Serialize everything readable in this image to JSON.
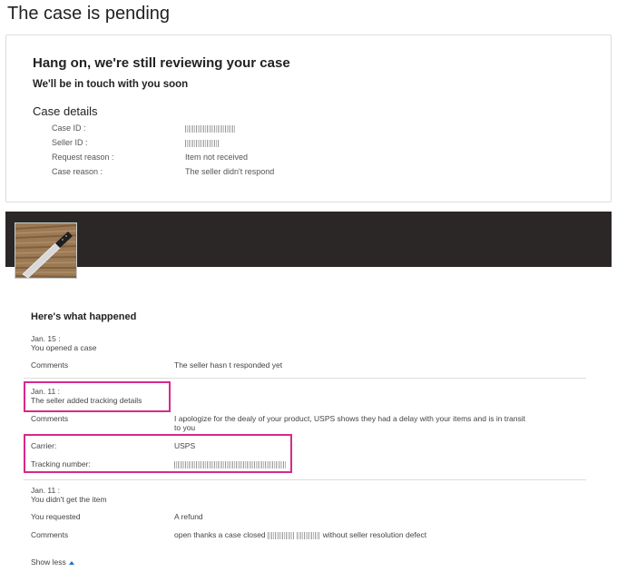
{
  "page": {
    "title": "The case is pending"
  },
  "review": {
    "heading": "Hang on, we're still reviewing your case",
    "subheading": "We'll be in touch with you soon",
    "details_heading": "Case details",
    "details": [
      {
        "label": "Case ID :",
        "value": ""
      },
      {
        "label": "Seller ID :",
        "value": ""
      },
      {
        "label": "Request reason :",
        "value": "Item not received"
      },
      {
        "label": "Case reason :",
        "value": "The seller didn't respond"
      }
    ]
  },
  "item": {
    "thumbnail_icon": "knife-on-wood-image"
  },
  "timeline": {
    "heading": "Here's what happened",
    "events": [
      {
        "date": "Jan. 15 :",
        "title": "You opened a case",
        "comments_label": "Comments",
        "comments_value": "The seller hasn t responded yet"
      },
      {
        "date": "Jan. 11 :",
        "title": "The seller added tracking details",
        "comments_label": "Comments",
        "comments_value_line1": "I apologize for the dealy of your product, USPS shows they had a delay with your items and is in transit",
        "comments_value_line2": "to you",
        "carrier_label": "Carrier:",
        "carrier_value": "USPS",
        "tracking_label": "Tracking number:",
        "tracking_value": ""
      },
      {
        "date": "Jan. 11 :",
        "title": "You didn't get the item",
        "requested_label": "You requested",
        "requested_value": "A refund",
        "comments_label": "Comments",
        "comments_pre": "open thanks a case closed",
        "comments_post": "without seller resolution defect"
      }
    ]
  },
  "show_less": "Show less",
  "colors": {
    "highlight": "#d6298a",
    "banner": "#2b2726",
    "link_caret": "#1a73c9"
  }
}
